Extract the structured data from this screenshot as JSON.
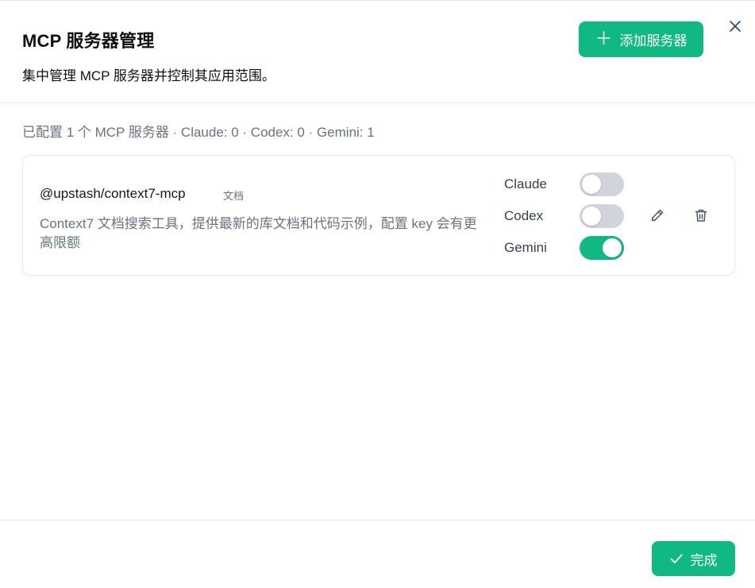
{
  "dialog": {
    "title": "MCP 服务器管理",
    "subtitle": "集中管理 MCP 服务器并控制其应用范围。",
    "add_button": {
      "label": "添加服务器",
      "icon": "plus-icon"
    },
    "close_icon": "close-icon"
  },
  "summary": "已配置 1 个 MCP 服务器 · Claude: 0 · Codex: 0 · Gemini: 1",
  "servers": [
    {
      "name": "@upstash/context7-mcp",
      "tag": "文档",
      "description": "Context7 文档搜索工具，提供最新的库文档和代码示例，配置 key 会有更高限额",
      "apps": [
        {
          "label": "Claude",
          "enabled": false
        },
        {
          "label": "Codex",
          "enabled": false
        },
        {
          "label": "Gemini",
          "enabled": true
        }
      ],
      "actions": [
        "edit-icon",
        "trash-icon"
      ]
    }
  ],
  "footer": {
    "done_label": "完成",
    "done_icon": "check-icon"
  },
  "colors": {
    "accent": "#10b981",
    "toggle_off": "#d1d5db",
    "muted_text": "#6b7280",
    "border": "#e5e7eb"
  }
}
